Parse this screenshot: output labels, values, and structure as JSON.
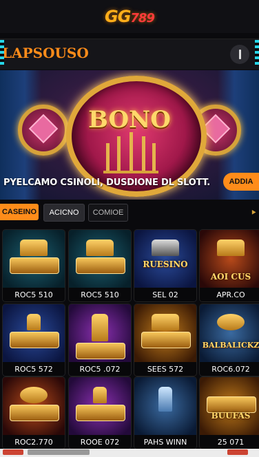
{
  "brand": {
    "logo_text": "GG",
    "logo_num": "789"
  },
  "header": {
    "title": "LAPSOUSO"
  },
  "banner": {
    "title": "BONO",
    "text": "PYELCAMO CSINOLI, DUSDIONE DL SLOTT.",
    "button_label": "ADDIA"
  },
  "tabs": [
    {
      "label": "CASEINO"
    },
    {
      "label": "ACICNO"
    },
    {
      "label": "COMIOE"
    }
  ],
  "games": [
    {
      "title": "",
      "code": "ROC5 510"
    },
    {
      "title": "",
      "code": "ROC5 510"
    },
    {
      "title": "RUESINO",
      "code": "SEL 02"
    },
    {
      "title": "AOI CUS",
      "code": "APR.CO"
    },
    {
      "title": "",
      "code": "ROC5 572"
    },
    {
      "title": "",
      "code": "ROC5 .072"
    },
    {
      "title": "",
      "code": "SEES 572"
    },
    {
      "title": "BALBALICKZ",
      "code": "ROC6.072"
    },
    {
      "title": "",
      "code": "ROC2.770"
    },
    {
      "title": "",
      "code": "ROOE 072"
    },
    {
      "title": "PAHS WINN",
      "code": ""
    },
    {
      "title": "BUUFAS",
      "code": "25 071"
    }
  ],
  "colors": {
    "accent": "#ff8c1a",
    "bg": "#0a0a0d",
    "gold": "#ffd86b"
  }
}
